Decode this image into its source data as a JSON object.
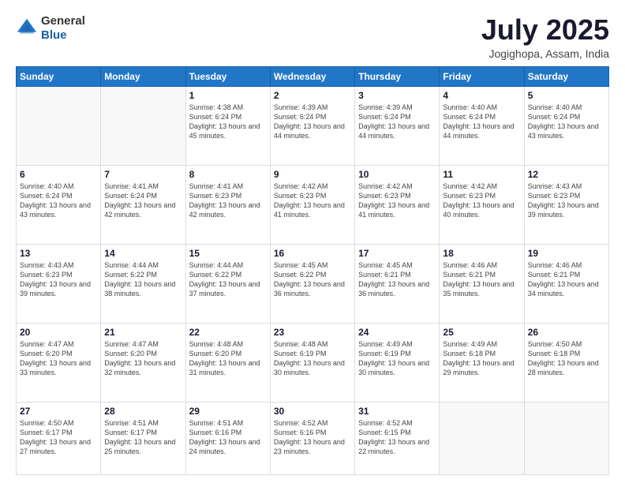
{
  "header": {
    "logo": {
      "general": "General",
      "blue": "Blue",
      "alt": "GeneralBlue Logo"
    },
    "title": "July 2025",
    "location": "Jogighopa, Assam, India"
  },
  "calendar": {
    "weekdays": [
      "Sunday",
      "Monday",
      "Tuesday",
      "Wednesday",
      "Thursday",
      "Friday",
      "Saturday"
    ],
    "weeks": [
      [
        {
          "day": "",
          "empty": true
        },
        {
          "day": "",
          "empty": true
        },
        {
          "day": "1",
          "sunrise": "4:38 AM",
          "sunset": "6:24 PM",
          "daylight": "13 hours and 45 minutes."
        },
        {
          "day": "2",
          "sunrise": "4:39 AM",
          "sunset": "6:24 PM",
          "daylight": "13 hours and 44 minutes."
        },
        {
          "day": "3",
          "sunrise": "4:39 AM",
          "sunset": "6:24 PM",
          "daylight": "13 hours and 44 minutes."
        },
        {
          "day": "4",
          "sunrise": "4:40 AM",
          "sunset": "6:24 PM",
          "daylight": "13 hours and 44 minutes."
        },
        {
          "day": "5",
          "sunrise": "4:40 AM",
          "sunset": "6:24 PM",
          "daylight": "13 hours and 43 minutes."
        }
      ],
      [
        {
          "day": "6",
          "sunrise": "4:40 AM",
          "sunset": "6:24 PM",
          "daylight": "13 hours and 43 minutes."
        },
        {
          "day": "7",
          "sunrise": "4:41 AM",
          "sunset": "6:24 PM",
          "daylight": "13 hours and 42 minutes."
        },
        {
          "day": "8",
          "sunrise": "4:41 AM",
          "sunset": "6:23 PM",
          "daylight": "13 hours and 42 minutes."
        },
        {
          "day": "9",
          "sunrise": "4:42 AM",
          "sunset": "6:23 PM",
          "daylight": "13 hours and 41 minutes."
        },
        {
          "day": "10",
          "sunrise": "4:42 AM",
          "sunset": "6:23 PM",
          "daylight": "13 hours and 41 minutes."
        },
        {
          "day": "11",
          "sunrise": "4:42 AM",
          "sunset": "6:23 PM",
          "daylight": "13 hours and 40 minutes."
        },
        {
          "day": "12",
          "sunrise": "4:43 AM",
          "sunset": "6:23 PM",
          "daylight": "13 hours and 39 minutes."
        }
      ],
      [
        {
          "day": "13",
          "sunrise": "4:43 AM",
          "sunset": "6:23 PM",
          "daylight": "13 hours and 39 minutes."
        },
        {
          "day": "14",
          "sunrise": "4:44 AM",
          "sunset": "6:22 PM",
          "daylight": "13 hours and 38 minutes."
        },
        {
          "day": "15",
          "sunrise": "4:44 AM",
          "sunset": "6:22 PM",
          "daylight": "13 hours and 37 minutes."
        },
        {
          "day": "16",
          "sunrise": "4:45 AM",
          "sunset": "6:22 PM",
          "daylight": "13 hours and 36 minutes."
        },
        {
          "day": "17",
          "sunrise": "4:45 AM",
          "sunset": "6:21 PM",
          "daylight": "13 hours and 36 minutes."
        },
        {
          "day": "18",
          "sunrise": "4:46 AM",
          "sunset": "6:21 PM",
          "daylight": "13 hours and 35 minutes."
        },
        {
          "day": "19",
          "sunrise": "4:46 AM",
          "sunset": "6:21 PM",
          "daylight": "13 hours and 34 minutes."
        }
      ],
      [
        {
          "day": "20",
          "sunrise": "4:47 AM",
          "sunset": "6:20 PM",
          "daylight": "13 hours and 33 minutes."
        },
        {
          "day": "21",
          "sunrise": "4:47 AM",
          "sunset": "6:20 PM",
          "daylight": "13 hours and 32 minutes."
        },
        {
          "day": "22",
          "sunrise": "4:48 AM",
          "sunset": "6:20 PM",
          "daylight": "13 hours and 31 minutes."
        },
        {
          "day": "23",
          "sunrise": "4:48 AM",
          "sunset": "6:19 PM",
          "daylight": "13 hours and 30 minutes."
        },
        {
          "day": "24",
          "sunrise": "4:49 AM",
          "sunset": "6:19 PM",
          "daylight": "13 hours and 30 minutes."
        },
        {
          "day": "25",
          "sunrise": "4:49 AM",
          "sunset": "6:18 PM",
          "daylight": "13 hours and 29 minutes."
        },
        {
          "day": "26",
          "sunrise": "4:50 AM",
          "sunset": "6:18 PM",
          "daylight": "13 hours and 28 minutes."
        }
      ],
      [
        {
          "day": "27",
          "sunrise": "4:50 AM",
          "sunset": "6:17 PM",
          "daylight": "13 hours and 27 minutes."
        },
        {
          "day": "28",
          "sunrise": "4:51 AM",
          "sunset": "6:17 PM",
          "daylight": "13 hours and 25 minutes."
        },
        {
          "day": "29",
          "sunrise": "4:51 AM",
          "sunset": "6:16 PM",
          "daylight": "13 hours and 24 minutes."
        },
        {
          "day": "30",
          "sunrise": "4:52 AM",
          "sunset": "6:16 PM",
          "daylight": "13 hours and 23 minutes."
        },
        {
          "day": "31",
          "sunrise": "4:52 AM",
          "sunset": "6:15 PM",
          "daylight": "13 hours and 22 minutes."
        },
        {
          "day": "",
          "empty": true
        },
        {
          "day": "",
          "empty": true
        }
      ]
    ]
  }
}
